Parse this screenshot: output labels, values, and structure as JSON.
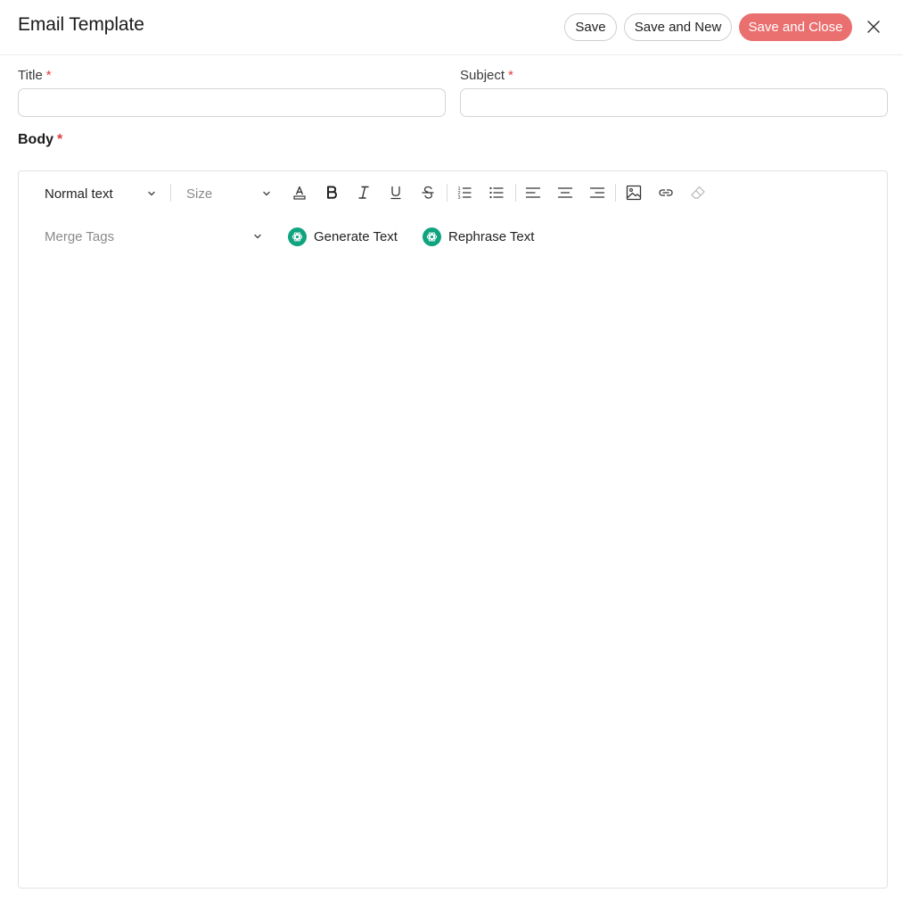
{
  "header": {
    "title": "Email Template",
    "save_label": "Save",
    "save_new_label": "Save and New",
    "save_close_label": "Save and Close"
  },
  "form": {
    "title_label": "Title",
    "subject_label": "Subject",
    "required_mark": "*",
    "title_value": "",
    "subject_value": "",
    "body_label": "Body"
  },
  "toolbar": {
    "text_style": "Normal text",
    "size_placeholder": "Size",
    "merge_tags_placeholder": "Merge Tags",
    "generate_text_label": "Generate Text",
    "rephrase_text_label": "Rephrase Text",
    "icons": [
      "font-color-icon",
      "bold-icon",
      "italic-icon",
      "underline-icon",
      "strikethrough-icon",
      "ordered-list-icon",
      "bullet-list-icon",
      "align-left-icon",
      "align-center-icon",
      "align-right-icon",
      "image-icon",
      "link-icon",
      "eraser-icon"
    ]
  },
  "colors": {
    "accent": "#ea6f6f",
    "ai_green": "#10a37f",
    "required": "#e03e3e"
  }
}
